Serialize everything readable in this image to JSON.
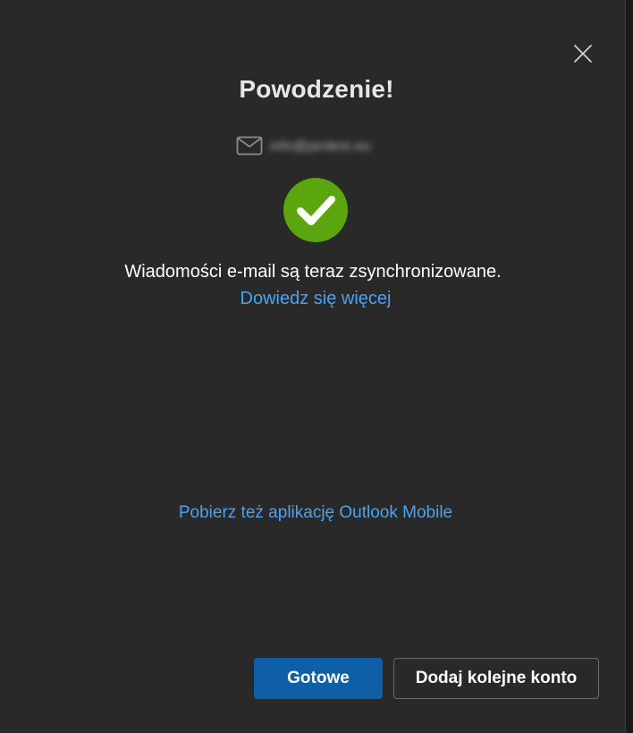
{
  "dialog": {
    "title": "Powodzenie!",
    "account_email": "info@jardest.eu",
    "message": "Wiadomości e-mail są teraz zsynchronizowane.",
    "learn_more_link": "Dowiedz się więcej",
    "mobile_app_link": "Pobierz też aplikację Outlook Mobile",
    "buttons": {
      "done": "Gotowe",
      "add_another_account": "Dodaj kolejne konto"
    }
  },
  "icons": {
    "close": "close-icon",
    "mail": "mail-icon",
    "success": "checkmark-circle-icon"
  },
  "colors": {
    "background": "#292929",
    "success_green": "#5ba50f",
    "link_blue": "#4aa3f0",
    "primary_button": "#0f5fa8"
  }
}
